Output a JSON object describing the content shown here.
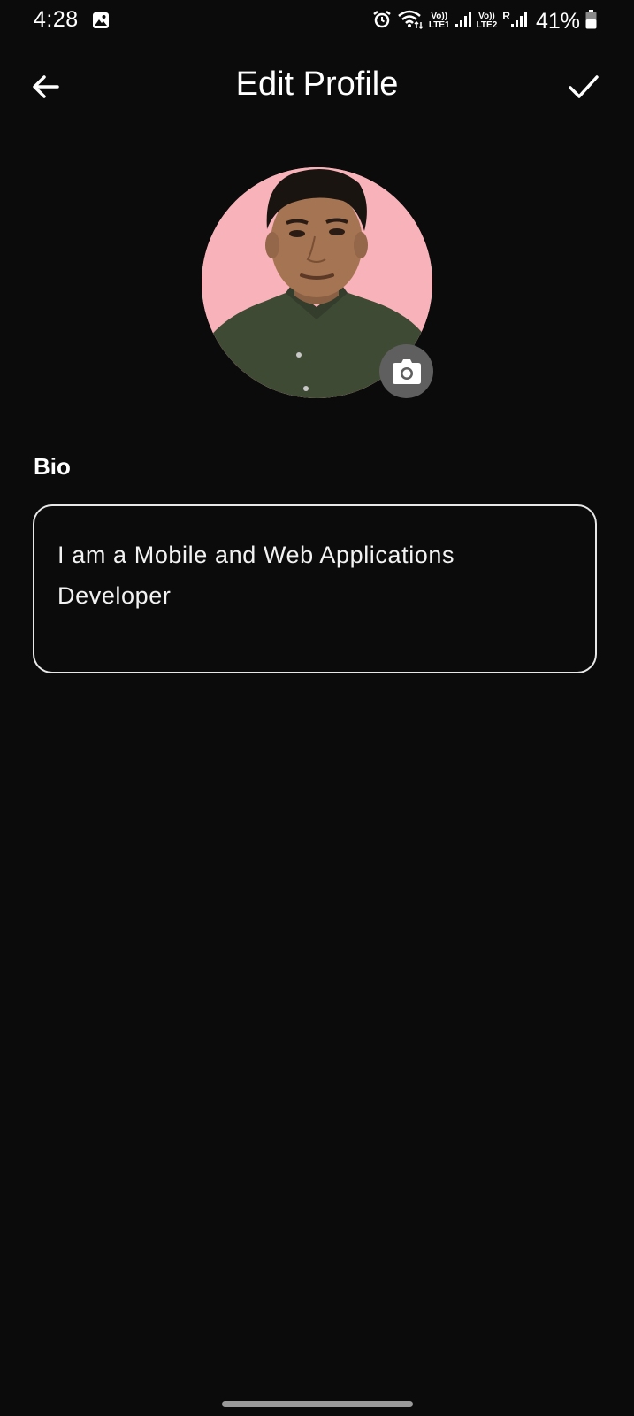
{
  "status_bar": {
    "time": "4:28",
    "network_1": {
      "top": "Vo))",
      "bottom": "LTE1"
    },
    "network_2": {
      "top": "Vo))",
      "bottom": "LTE2"
    },
    "roaming": "R",
    "battery": "41%",
    "icons": [
      "gallery-icon",
      "alarm-icon",
      "wifi-icon",
      "signal-icon",
      "battery-icon"
    ]
  },
  "app_bar": {
    "title": "Edit Profile",
    "back_icon": "arrow-left-icon",
    "confirm_icon": "check-icon"
  },
  "profile": {
    "avatar_background": "#f7b3b9",
    "camera_icon": "camera-icon"
  },
  "bio": {
    "label": "Bio",
    "value": "I am a Mobile and Web Applications Developer"
  },
  "colors": {
    "background": "#0b0b0b",
    "text": "#ffffff",
    "field_border": "#e8e8e8",
    "camera_button": "#5f5f5f"
  }
}
